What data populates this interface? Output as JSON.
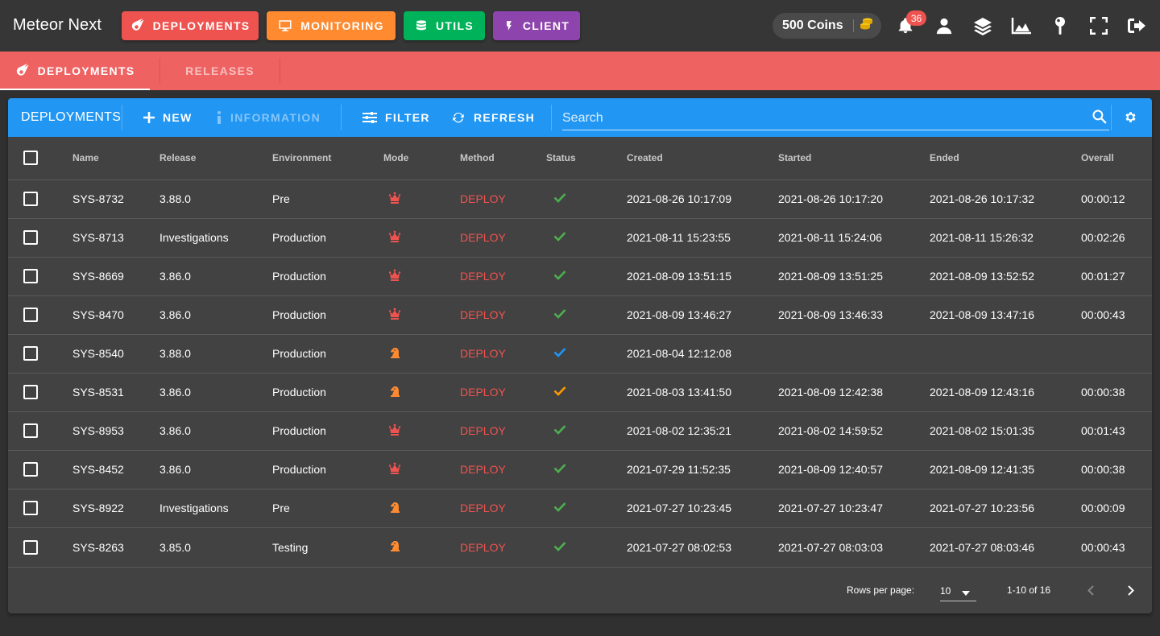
{
  "app": {
    "title": "Meteor Next"
  },
  "nav": {
    "deployments": "DEPLOYMENTS",
    "monitoring": "MONITORING",
    "utils": "UTILS",
    "client": "CLIENT"
  },
  "coins": {
    "label": "500 Coins"
  },
  "notifications": {
    "count": "36"
  },
  "tabs": {
    "deployments": "DEPLOYMENTS",
    "releases": "RELEASES"
  },
  "toolbar": {
    "title": "DEPLOYMENTS",
    "new": "NEW",
    "information": "INFORMATION",
    "filter": "FILTER",
    "refresh": "REFRESH",
    "search_placeholder": "Search"
  },
  "table": {
    "headers": {
      "name": "Name",
      "release": "Release",
      "environment": "Environment",
      "mode": "Mode",
      "method": "Method",
      "status": "Status",
      "created": "Created",
      "started": "Started",
      "ended": "Ended",
      "overall": "Overall"
    },
    "rows": [
      {
        "name": "SYS-8732",
        "release": "3.88.0",
        "environment": "Pre",
        "mode": "crown-icon",
        "method": "DEPLOY",
        "status": "success",
        "created": "2021-08-26 10:17:09",
        "started": "2021-08-26 10:17:20",
        "ended": "2021-08-26 10:17:32",
        "overall": "00:00:12"
      },
      {
        "name": "SYS-8713",
        "release": "Investigations",
        "environment": "Production",
        "mode": "crown-icon",
        "method": "DEPLOY",
        "status": "success",
        "created": "2021-08-11 15:23:55",
        "started": "2021-08-11 15:24:06",
        "ended": "2021-08-11 15:26:32",
        "overall": "00:02:26"
      },
      {
        "name": "SYS-8669",
        "release": "3.86.0",
        "environment": "Production",
        "mode": "crown-icon",
        "method": "DEPLOY",
        "status": "success",
        "created": "2021-08-09 13:51:15",
        "started": "2021-08-09 13:51:25",
        "ended": "2021-08-09 13:52:52",
        "overall": "00:01:27"
      },
      {
        "name": "SYS-8470",
        "release": "3.86.0",
        "environment": "Production",
        "mode": "crown-icon",
        "method": "DEPLOY",
        "status": "success",
        "created": "2021-08-09 13:46:27",
        "started": "2021-08-09 13:46:33",
        "ended": "2021-08-09 13:47:16",
        "overall": "00:00:43"
      },
      {
        "name": "SYS-8540",
        "release": "3.88.0",
        "environment": "Production",
        "mode": "knight-icon",
        "method": "DEPLOY",
        "status": "validated",
        "created": "2021-08-04 12:12:08",
        "started": "",
        "ended": "",
        "overall": ""
      },
      {
        "name": "SYS-8531",
        "release": "3.86.0",
        "environment": "Production",
        "mode": "knight-icon",
        "method": "DEPLOY",
        "status": "warning",
        "created": "2021-08-03 13:41:50",
        "started": "2021-08-09 12:42:38",
        "ended": "2021-08-09 12:43:16",
        "overall": "00:00:38"
      },
      {
        "name": "SYS-8953",
        "release": "3.86.0",
        "environment": "Production",
        "mode": "crown-icon",
        "method": "DEPLOY",
        "status": "success",
        "created": "2021-08-02 12:35:21",
        "started": "2021-08-02 14:59:52",
        "ended": "2021-08-02 15:01:35",
        "overall": "00:01:43"
      },
      {
        "name": "SYS-8452",
        "release": "3.86.0",
        "environment": "Production",
        "mode": "crown-icon",
        "method": "DEPLOY",
        "status": "success",
        "created": "2021-07-29 11:52:35",
        "started": "2021-08-09 12:40:57",
        "ended": "2021-08-09 12:41:35",
        "overall": "00:00:38"
      },
      {
        "name": "SYS-8922",
        "release": "Investigations",
        "environment": "Pre",
        "mode": "knight-icon",
        "method": "DEPLOY",
        "status": "success",
        "created": "2021-07-27 10:23:45",
        "started": "2021-07-27 10:23:47",
        "ended": "2021-07-27 10:23:56",
        "overall": "00:00:09"
      },
      {
        "name": "SYS-8263",
        "release": "3.85.0",
        "environment": "Testing",
        "mode": "knight-icon",
        "method": "DEPLOY",
        "status": "success",
        "created": "2021-07-27 08:02:53",
        "started": "2021-07-27 08:03:03",
        "ended": "2021-07-27 08:03:46",
        "overall": "00:00:43"
      }
    ]
  },
  "footer": {
    "rows_per_page_label": "Rows per page:",
    "rows_per_page": "10",
    "range": "1-10 of 16"
  },
  "colors": {
    "deployments": "#ef5350",
    "monitoring": "#ff8a30",
    "utils": "#00b259",
    "client": "#8e44ad",
    "tabs_bg": "#ef6262",
    "toolbar": "#2196f3",
    "status_success": "#4caf50",
    "status_validated": "#2196f3",
    "status_warning": "#ff9800",
    "mode_crown": "#ef5350",
    "mode_knight": "#ff8a30"
  }
}
